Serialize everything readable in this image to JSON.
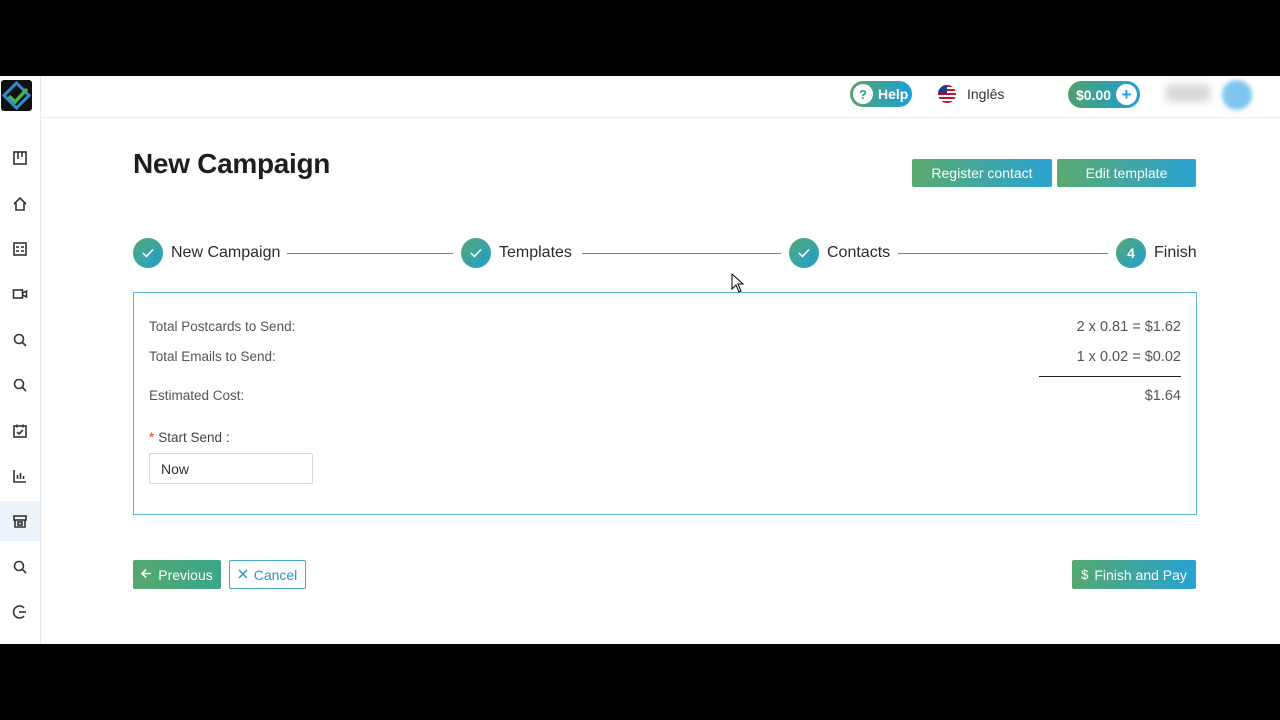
{
  "header": {
    "help_label": "Help",
    "help_icon": "?",
    "language_label": "Inglês",
    "balance_label": "$0.00",
    "balance_add_icon": "+"
  },
  "page": {
    "title": "New Campaign",
    "register_contact_label": "Register contact",
    "edit_template_label": "Edit template"
  },
  "steps": [
    {
      "label": "New Campaign",
      "status": "done"
    },
    {
      "label": "Templates",
      "status": "done"
    },
    {
      "label": "Contacts",
      "status": "done"
    },
    {
      "label": "Finish",
      "status": "current",
      "number": "4"
    }
  ],
  "summary": {
    "postcards_label": "Total Postcards to Send:",
    "postcards_value": "2 x 0.81 = $1.62",
    "emails_label": "Total Emails to Send:",
    "emails_value": "1 x 0.02 = $0.02",
    "estimated_label": "Estimated Cost:",
    "estimated_value": "$1.64",
    "start_send_label": "Start Send",
    "start_send_value": "Now"
  },
  "actions": {
    "previous_label": "Previous",
    "cancel_label": "Cancel",
    "finish_label": "Finish and Pay"
  },
  "sidebar": {
    "icons": [
      "board-icon",
      "home-icon",
      "calculator-icon",
      "video-icon",
      "search-icon",
      "search-icon",
      "calendar-check-icon",
      "bar-chart-icon",
      "store-icon",
      "search-icon",
      "logout-icon"
    ]
  },
  "colors": {
    "brand_green": "#55a86d",
    "brand_blue": "#1f9fd6",
    "border_blue": "#5bb8d6"
  }
}
